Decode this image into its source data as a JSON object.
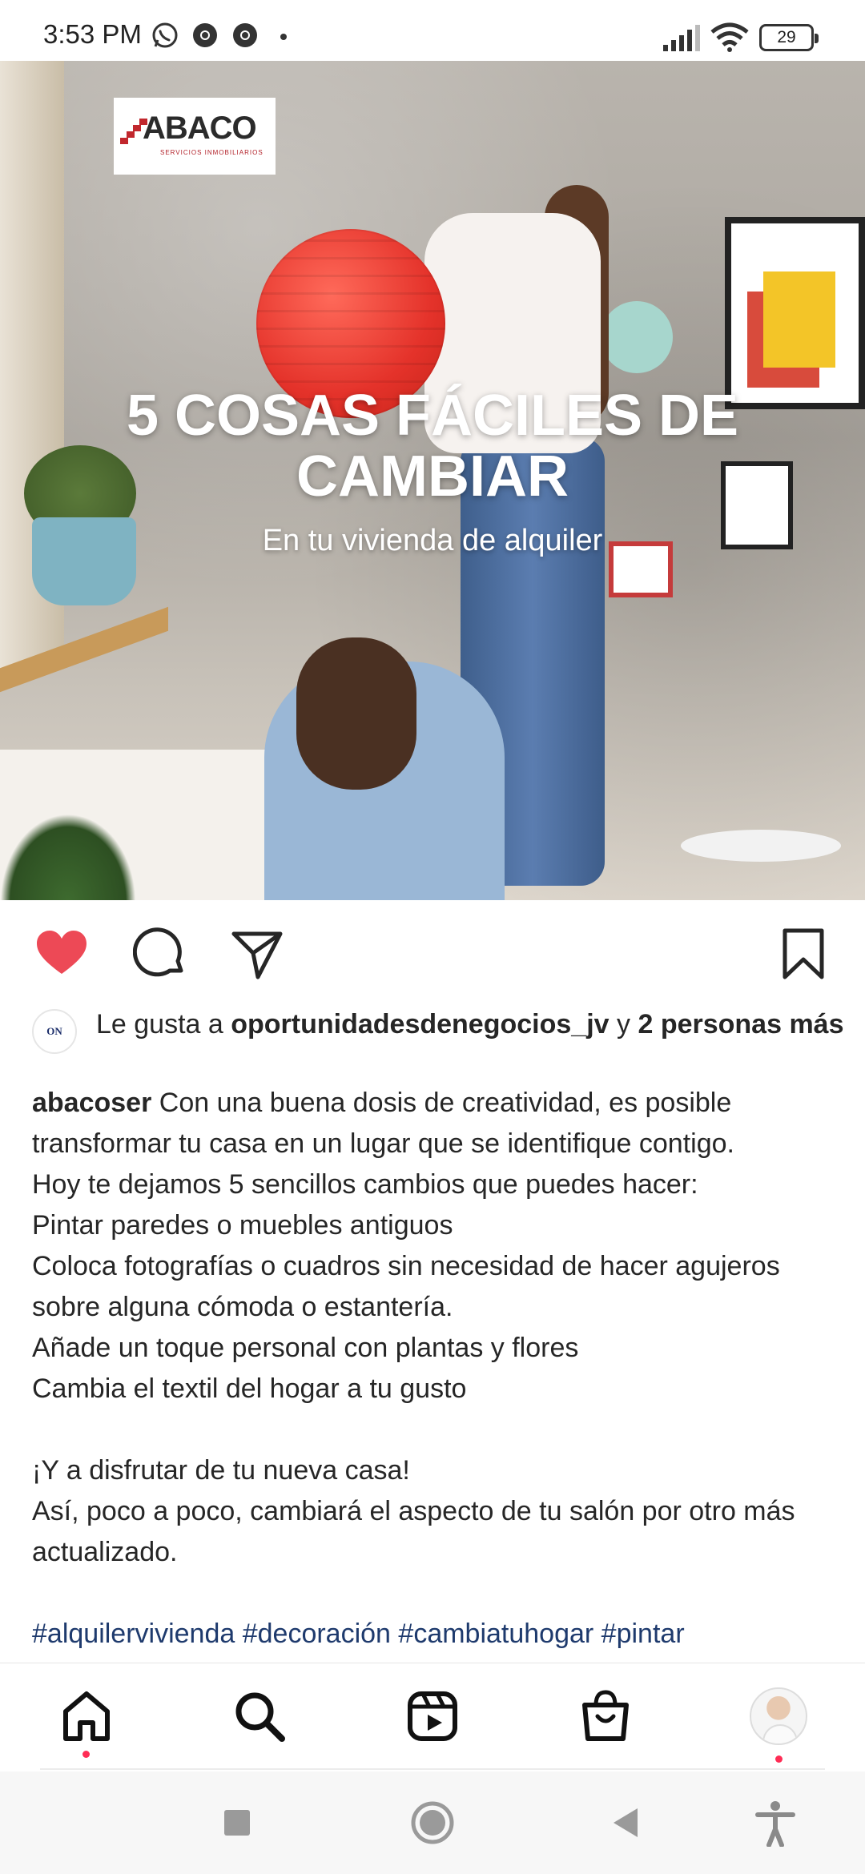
{
  "status_bar": {
    "time": "3:53 PM",
    "app_icons": [
      "whatsapp-icon",
      "chrome-icon",
      "chrome-icon"
    ],
    "battery": "29",
    "signal_icon": "cell-signal-icon",
    "wifi_icon": "wifi-icon"
  },
  "post": {
    "image": {
      "logo_text": "ABACO",
      "logo_sub": "SERVICIOS INMOBILIARIOS",
      "title_line1": "5 COSAS FÁCILES DE",
      "title_line2": "CAMBIAR",
      "subtitle": "En tu vivienda de alquiler"
    },
    "actions": {
      "like_icon": "heart-filled-icon",
      "comment_icon": "comment-icon",
      "share_icon": "send-icon",
      "save_icon": "bookmark-icon",
      "like_color": "#ed4956"
    },
    "likes": {
      "avatar_text": "ON",
      "prefix": "Le gusta a ",
      "user": "oportunidadesdenegocios_jv",
      "middle": " y ",
      "others": "2 personas más"
    },
    "caption": {
      "username": "abacoser",
      "first_line": " Con una buena dosis de creatividad, es posible transformar tu casa en un lugar que se identifique contigo.",
      "lines": [
        "Hoy te dejamos 5 sencillos cambios que puedes hacer:",
        "Pintar paredes o muebles antiguos",
        "Coloca fotografías o cuadros sin necesidad de hacer agujeros sobre alguna cómoda o estantería.",
        "Añade un toque personal con plantas y flores",
        "Cambia el textil del hogar a tu gusto",
        "",
        "¡Y a disfrutar de tu nueva casa!",
        "Así, poco a poco, cambiará el aspecto de tu salón por otro más actualizado."
      ],
      "hashtags": "#alquilervivienda #decoración #cambiatuhogar #pintar"
    }
  },
  "bottom_nav": {
    "items": [
      "home-icon",
      "search-icon",
      "reels-icon",
      "shop-icon",
      "profile-avatar"
    ],
    "dot_color": "#ff2d55"
  },
  "system_nav": {
    "items": [
      "recent-apps-icon",
      "home-circle-icon",
      "back-icon",
      "accessibility-icon"
    ]
  }
}
